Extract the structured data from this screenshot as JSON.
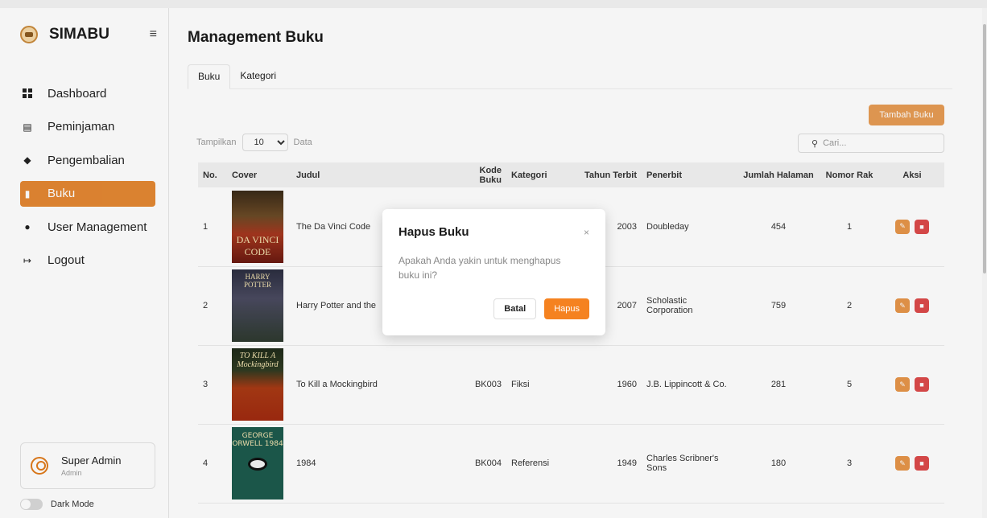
{
  "sidebar": {
    "brand": "SIMABU",
    "menu_icon": "hamburger-icon",
    "items": [
      {
        "label": "Dashboard",
        "icon": "dashboard-icon"
      },
      {
        "label": "Peminjaman",
        "icon": "book-icon"
      },
      {
        "label": "Pengembalian",
        "icon": "layers-icon"
      },
      {
        "label": "Buku",
        "icon": "library-icon",
        "active": true
      },
      {
        "label": "User Management",
        "icon": "users-icon"
      },
      {
        "label": "Logout",
        "icon": "logout-icon"
      }
    ],
    "user": {
      "name": "Super Admin",
      "role": "Admin"
    },
    "dark_mode_label": "Dark Mode"
  },
  "main": {
    "title": "Management Buku",
    "tabs": [
      "Buku",
      "Kategori"
    ],
    "add_button": "Tambah Buku",
    "show_label_before": "Tampilkan",
    "page_size": "10",
    "show_label_after": "Data",
    "search_placeholder": "Cari..."
  },
  "table": {
    "headers": [
      "No.",
      "Cover",
      "Judul",
      "Kode Buku",
      "Kategori",
      "Tahun Terbit",
      "Penerbit",
      "Jumlah Halaman",
      "Nomor Rak",
      "Aksi"
    ],
    "rows": [
      {
        "no": "1",
        "title": "The Da Vinci Code",
        "code": "",
        "category": "",
        "year": "2003",
        "publisher": "Doubleday",
        "pages": "454",
        "shelf": "1",
        "cover_text": "DA VINCI CODE"
      },
      {
        "no": "2",
        "title": "Harry Potter and the",
        "code": "",
        "category": "",
        "year": "2007",
        "publisher": "Scholastic Corporation",
        "pages": "759",
        "shelf": "2",
        "cover_text": "HARRY POTTER"
      },
      {
        "no": "3",
        "title": "To Kill a Mockingbird",
        "code": "BK003",
        "category": "Fiksi",
        "year": "1960",
        "publisher": "J.B. Lippincott & Co.",
        "pages": "281",
        "shelf": "5",
        "cover_text": "TO KILL A Mockingbird"
      },
      {
        "no": "4",
        "title": "1984",
        "code": "BK004",
        "category": "Referensi",
        "year": "1949",
        "publisher": "Charles Scribner's Sons",
        "pages": "180",
        "shelf": "3",
        "cover_text": "GEORGE ORWELL 1984"
      }
    ]
  },
  "modal": {
    "title": "Hapus Buku",
    "message": "Apakah Anda yakin untuk menghapus buku ini?",
    "cancel": "Batal",
    "confirm": "Hapus",
    "close": "×"
  },
  "colors": {
    "accent": "#e07b1c",
    "danger": "#d62b2b",
    "confirm": "#f58220"
  }
}
